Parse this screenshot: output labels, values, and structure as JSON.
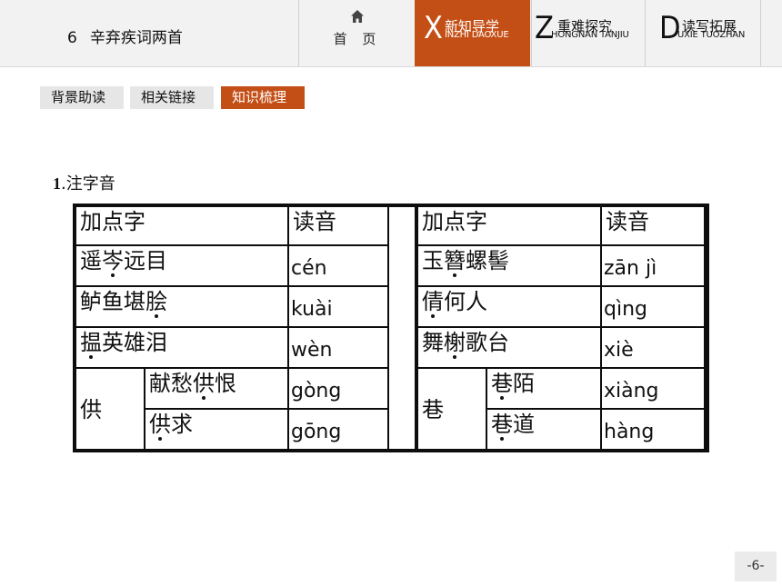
{
  "header": {
    "lesson_number": "6",
    "lesson_title": "辛弃疾词两首",
    "home_label": "首 页",
    "tabs": [
      {
        "letter": "X",
        "label": "新知导学",
        "pinyin": "INZHI DAOXUE",
        "active": true
      },
      {
        "letter": "Z",
        "label": "重难探究",
        "pinyin": "HONGNAN TANJIU",
        "active": false
      },
      {
        "letter": "D",
        "label": "读写拓展",
        "pinyin": "UXIE TUOZHAN",
        "active": false
      }
    ]
  },
  "subtabs": [
    {
      "label": "背景助读",
      "active": false
    },
    {
      "label": "相关链接",
      "active": false
    },
    {
      "label": "知识梳理",
      "active": true
    }
  ],
  "section_heading": {
    "number": "1",
    "text": ".注字音"
  },
  "table": {
    "headers": [
      "加点字",
      "读音",
      "加点字",
      "读音"
    ],
    "left_rows": [
      {
        "word": "遥岑远目",
        "dot_index": 1,
        "reading": "cén"
      },
      {
        "word": "鲈鱼堪脍",
        "dot_index": 3,
        "reading": "kuài"
      },
      {
        "word": "揾英雄泪",
        "dot_index": 0,
        "reading": "wèn"
      }
    ],
    "left_poly": {
      "char": "供",
      "items": [
        {
          "word": "献愁供恨",
          "dot_index": 2,
          "reading": "gòng"
        },
        {
          "word": "供求",
          "dot_index": 0,
          "reading": "gōng"
        }
      ]
    },
    "right_rows": [
      {
        "word": "玉簪螺髻",
        "dot_index": 1,
        "reading": "zān jì"
      },
      {
        "word": "倩何人",
        "dot_index": 0,
        "reading": "qìng"
      },
      {
        "word": "舞榭歌台",
        "dot_index": 1,
        "reading": "xiè"
      }
    ],
    "right_poly": {
      "char": "巷",
      "items": [
        {
          "word": "巷陌",
          "dot_index": 0,
          "reading": "xiàng"
        },
        {
          "word": "巷道",
          "dot_index": 0,
          "reading": "hàng"
        }
      ]
    }
  },
  "page_number": "-6-",
  "colors": {
    "accent": "#c44f16",
    "bar": "#f2f2f2",
    "border": "#0d0d0d"
  }
}
